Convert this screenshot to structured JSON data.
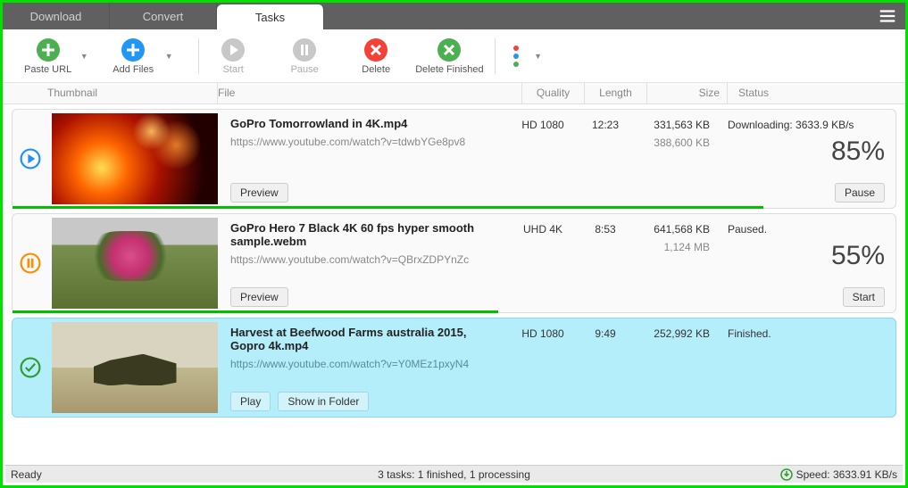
{
  "tabs": {
    "download": "Download",
    "convert": "Convert",
    "tasks": "Tasks"
  },
  "toolbar": {
    "paste_url": "Paste URL",
    "add_files": "Add Files",
    "start": "Start",
    "pause": "Pause",
    "delete": "Delete",
    "delete_finished": "Delete Finished"
  },
  "columns": {
    "thumbnail": "Thumbnail",
    "file": "File",
    "quality": "Quality",
    "length": "Length",
    "size": "Size",
    "status": "Status"
  },
  "tasks": [
    {
      "title": "GoPro  Tomorrowland in 4K.mp4",
      "url": "https://www.youtube.com/watch?v=tdwbYGe8pv8",
      "quality": "HD 1080",
      "length": "12:23",
      "size1": "331,563 KB",
      "size2": "388,600 KB",
      "status_text": "Downloading: 3633.9 KB/s",
      "percent": "85%",
      "progress": 85,
      "state": "downloading",
      "btn1": "Preview",
      "action": "Pause"
    },
    {
      "title": "GoPro Hero 7 Black 4K 60 fps hyper smooth sample.webm",
      "url": "https://www.youtube.com/watch?v=QBrxZDPYnZc",
      "quality": "UHD 4K",
      "length": "8:53",
      "size1": "641,568 KB",
      "size2": "1,124 MB",
      "status_text": "Paused.",
      "percent": "55%",
      "progress": 55,
      "state": "paused",
      "btn1": "Preview",
      "action": "Start"
    },
    {
      "title": "Harvest at Beefwood Farms australia 2015, Gopro 4k.mp4",
      "url": "https://www.youtube.com/watch?v=Y0MEz1pxyN4",
      "quality": "HD 1080",
      "length": "9:49",
      "size1": "252,992 KB",
      "size2": "",
      "status_text": "Finished.",
      "percent": "",
      "progress": 100,
      "state": "finished",
      "btn1": "Play",
      "btn2": "Show in Folder",
      "action": ""
    }
  ],
  "statusbar": {
    "ready": "Ready",
    "summary": "3 tasks: 1 finished, 1 processing",
    "speed": "Speed: 3633.91 KB/s"
  }
}
